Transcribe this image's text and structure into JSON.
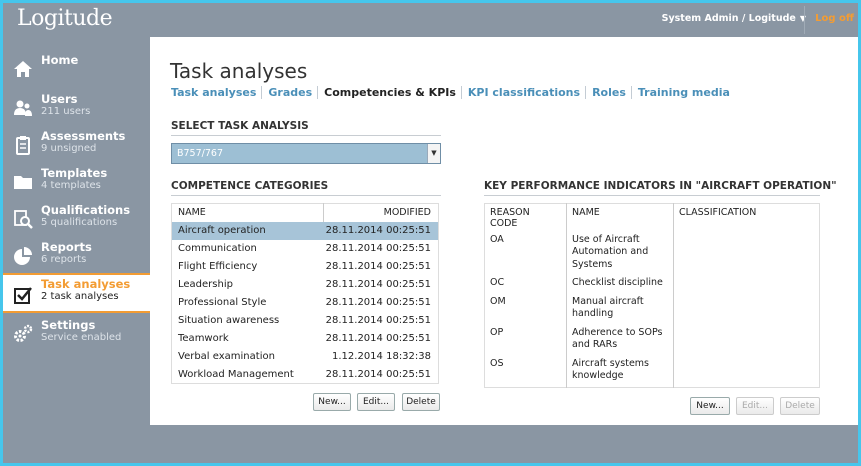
{
  "header": {
    "logo": "Logitude",
    "user_menu": "System Admin / Logitude",
    "logoff": "Log off"
  },
  "sidebar": {
    "items": [
      {
        "label": "Home",
        "sub": ""
      },
      {
        "label": "Users",
        "sub": "211 users"
      },
      {
        "label": "Assessments",
        "sub": "9 unsigned"
      },
      {
        "label": "Templates",
        "sub": "4 templates"
      },
      {
        "label": "Qualifications",
        "sub": "5 qualifications"
      },
      {
        "label": "Reports",
        "sub": "6 reports"
      },
      {
        "label": "Task analyses",
        "sub": "2 task analyses"
      },
      {
        "label": "Settings",
        "sub": "Service enabled"
      }
    ]
  },
  "main": {
    "title": "Task analyses",
    "tabs": [
      "Task analyses",
      "Grades",
      "Competencies & KPIs",
      "KPI classifications",
      "Roles",
      "Training media"
    ],
    "select_heading": "SELECT TASK ANALYSIS",
    "select_value": "B757/767",
    "competence": {
      "heading": "COMPETENCE CATEGORIES",
      "columns": [
        "NAME",
        "MODIFIED"
      ],
      "rows": [
        [
          "Aircraft operation",
          "28.11.2014 00:25:51"
        ],
        [
          "Communication",
          "28.11.2014 00:25:51"
        ],
        [
          "Flight Efficiency",
          "28.11.2014 00:25:51"
        ],
        [
          "Leadership",
          "28.11.2014 00:25:51"
        ],
        [
          "Professional Style",
          "28.11.2014 00:25:51"
        ],
        [
          "Situation awareness",
          "28.11.2014 00:25:51"
        ],
        [
          "Teamwork",
          "28.11.2014 00:25:51"
        ],
        [
          "Verbal examination",
          "1.12.2014 18:32:38"
        ],
        [
          "Workload Management",
          "28.11.2014 00:25:51"
        ]
      ],
      "buttons": [
        "New...",
        "Edit...",
        "Delete"
      ]
    },
    "kpi": {
      "heading": "KEY PERFORMANCE INDICATORS IN \"AIRCRAFT OPERATION\"",
      "columns": [
        "REASON\nCODE",
        "NAME",
        "CLASSIFICATION"
      ],
      "rows": [
        [
          "OA",
          "Use of Aircraft\nAutomation and\nSystems",
          ""
        ],
        [
          "OC",
          "Checklist discipline",
          ""
        ],
        [
          "OM",
          "Manual aircraft\nhandling",
          ""
        ],
        [
          "OP",
          "Adherence to SOPs\nand RARs",
          ""
        ],
        [
          "OS",
          "Aircraft systems\nknowledge",
          ""
        ]
      ],
      "buttons": [
        "New...",
        "Edit...",
        "Delete"
      ]
    }
  },
  "colors": {
    "accent": "#f39c33",
    "link": "#4a8fb8",
    "sidebar": "#8a96a3",
    "selection": "#a7c4d8"
  }
}
